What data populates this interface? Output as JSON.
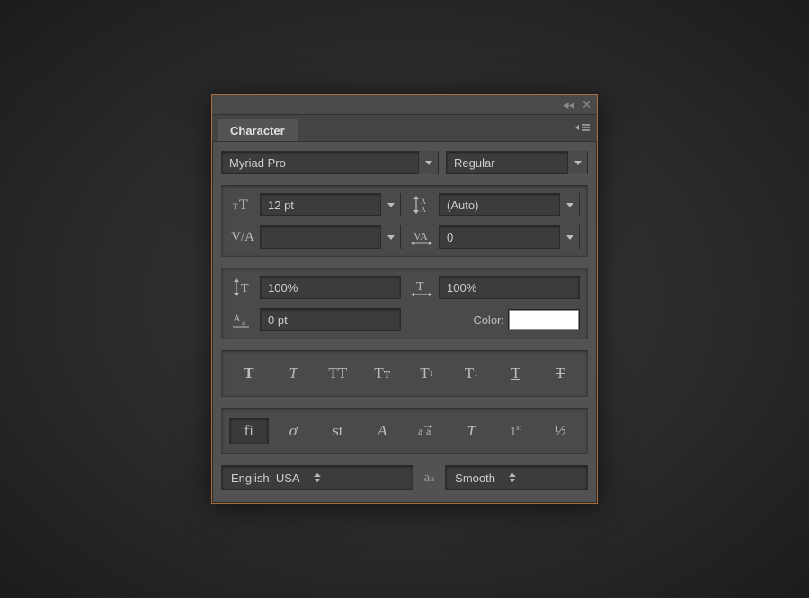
{
  "panel": {
    "title": "Character",
    "font_family": "Myriad Pro",
    "font_style": "Regular",
    "font_size": "12 pt",
    "leading": "(Auto)",
    "kerning": "",
    "tracking": "0",
    "vscale": "100%",
    "hscale": "100%",
    "baseline": "0 pt",
    "color_label": "Color:",
    "color_value": "#ffffff",
    "style_buttons": {
      "bold": "T",
      "italic": "T",
      "allcaps": "TT",
      "smallcaps": "Tᴛ",
      "superscript_base": "T",
      "subscript_base": "T",
      "underline": "T",
      "strike": "T"
    },
    "ot_buttons": {
      "ligatures": "fi",
      "contextual": "ơ",
      "discretionary": "st",
      "swash": "A",
      "stylistic": "aa",
      "titling": "T",
      "ordinals": "1st",
      "fractions": "½"
    },
    "language": "English: USA",
    "antialias": "Smooth"
  }
}
